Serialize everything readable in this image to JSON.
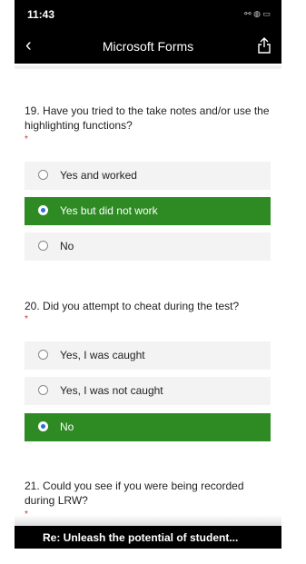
{
  "status": {
    "time": "11:43",
    "indicators": "⚯ ◍ ▭"
  },
  "appbar": {
    "title": "Microsoft Forms",
    "back_icon": "chevron-left-icon",
    "share_icon": "share-icon"
  },
  "questions": [
    {
      "number": "19.",
      "text": "Have you tried to the take notes and/or use the highlighting functions?",
      "required": "*",
      "options": [
        {
          "label": "Yes and worked",
          "selected": false
        },
        {
          "label": "Yes but did not work",
          "selected": true
        },
        {
          "label": "No",
          "selected": false
        }
      ]
    },
    {
      "number": "20.",
      "text": "Did you attempt to cheat during the test?",
      "required": "*",
      "options": [
        {
          "label": "Yes, I was caught",
          "selected": false
        },
        {
          "label": "Yes, I was not caught",
          "selected": false
        },
        {
          "label": "No",
          "selected": true
        }
      ]
    },
    {
      "number": "21.",
      "text": "Could you see if you were being recorded during LRW?",
      "required": "*"
    }
  ],
  "bottom_bar": {
    "text": "Re: Unleash the potential of student..."
  },
  "colors": {
    "selected": "#2e8b24",
    "radio_dot": "#2e6fd6",
    "required": "#c0392b"
  }
}
